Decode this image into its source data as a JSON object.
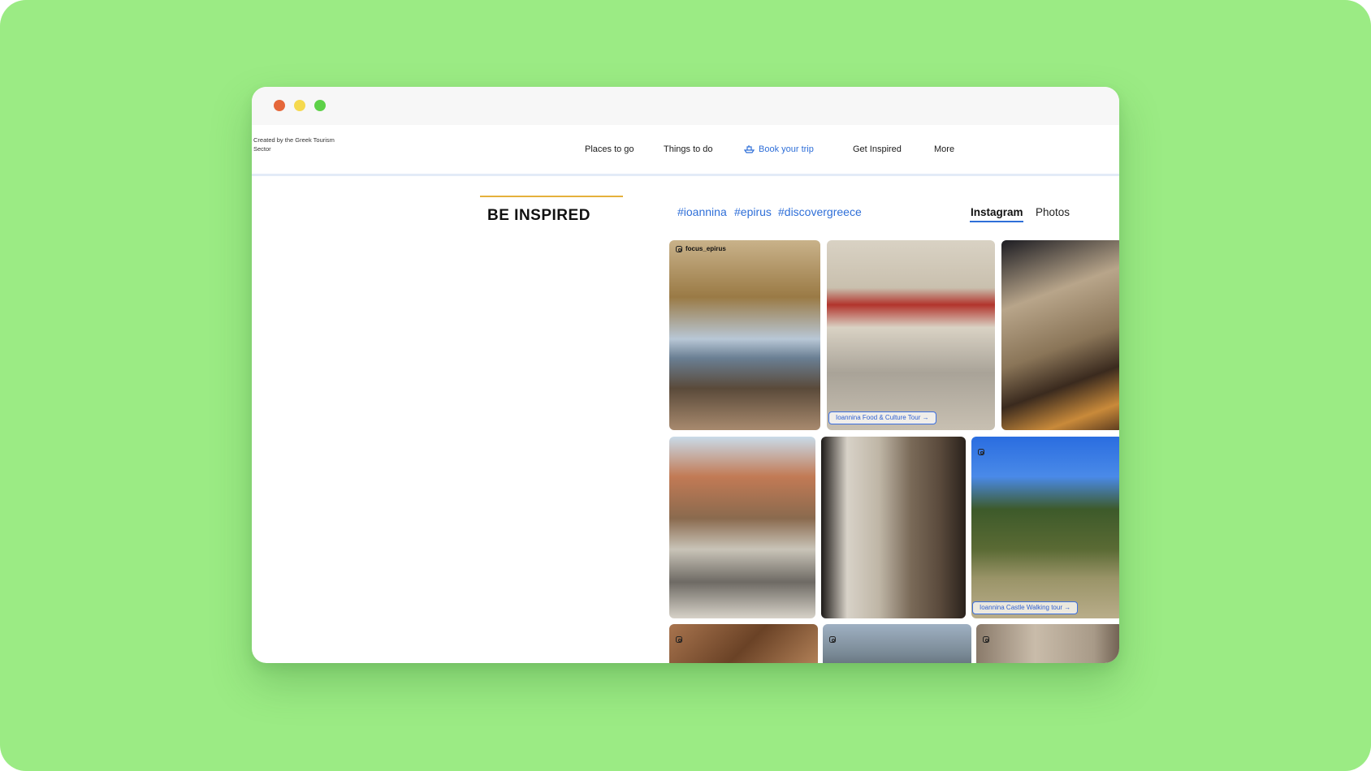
{
  "window": {
    "controls": [
      "close",
      "minimize",
      "maximize"
    ]
  },
  "brand": {
    "tagline": "Created by the Greek Tourism Sector"
  },
  "nav": {
    "items": [
      {
        "label": "Places to go"
      },
      {
        "label": "Things to do"
      },
      {
        "label": "Book your trip",
        "icon": "boat-icon",
        "active": true
      },
      {
        "label": "Get Inspired"
      },
      {
        "label": "More"
      }
    ]
  },
  "section": {
    "title": "BE INSPIRED",
    "hashtags": [
      "#ioannina",
      "#epirus",
      "#discovergreece"
    ],
    "tabs": [
      {
        "label": "Instagram",
        "active": true
      },
      {
        "label": "Photos"
      }
    ]
  },
  "gallery": {
    "tiles": [
      {
        "handle": "focus_epirus",
        "scene": "lakeside promenade with autumn trees"
      },
      {
        "tour_label": "Ioannina Food & Culture Tour",
        "scene": "red stone gate arch with Greek lettering"
      },
      {
        "scene": "neoclassical building with bokeh lights"
      },
      {
        "scene": "checkerboard paved street with old houses"
      },
      {
        "scene": "stone archway onto a cobbled street"
      },
      {
        "tour_label": "Ioannina Castle Walking tour",
        "scene": "large tree under blue sky"
      },
      {
        "scene": "autumn leaves"
      },
      {
        "scene": "lake and mountains"
      },
      {
        "scene": "stone wall"
      }
    ]
  },
  "colors": {
    "backdrop": "#9beb84",
    "accent": "#2f6fd8",
    "gold": "#e5b13c"
  }
}
